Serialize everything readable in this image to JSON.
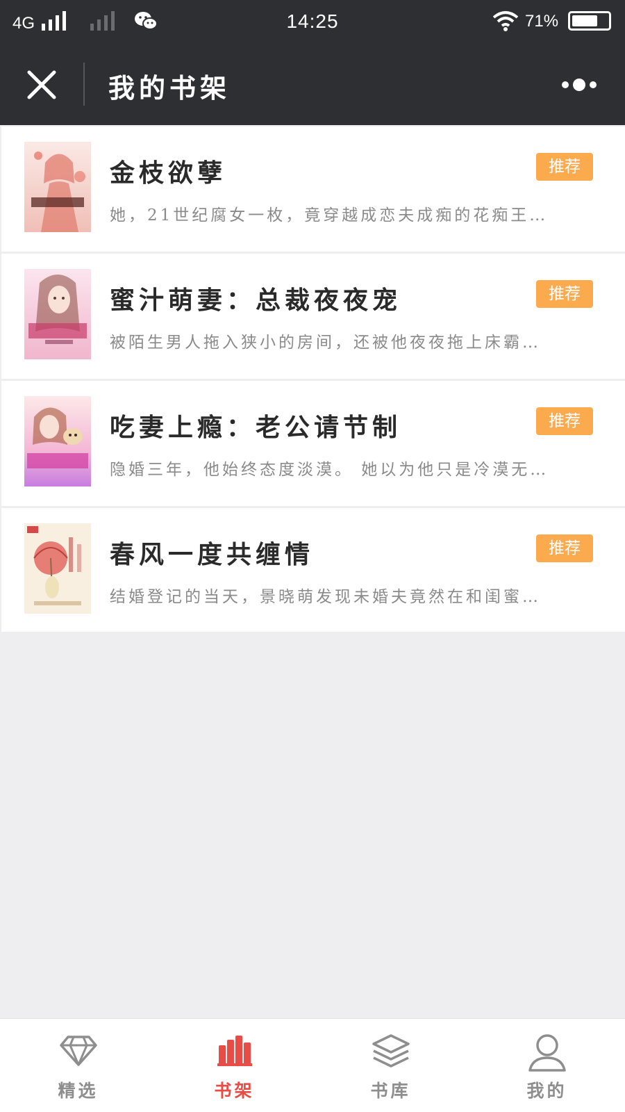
{
  "status_bar": {
    "network": "4G",
    "time": "14:25",
    "battery_percent": "71%",
    "battery_level": 0.71
  },
  "header": {
    "title": "我的书架",
    "close_icon": "close-icon",
    "more_icon": "more-icon"
  },
  "books": [
    {
      "title": "金枝欲孽",
      "description": "她，21世纪腐女一枚，竟穿越成恋夫成痴的花痴王…",
      "badge": "推荐",
      "cover_colors": [
        "#f4d8d4",
        "#e8a9a2"
      ]
    },
    {
      "title": "蜜汁萌妻：总裁夜夜宠",
      "description": "被陌生男人拖入狭小的房间，还被他夜夜拖上床霸…",
      "badge": "推荐",
      "cover_colors": [
        "#f8dbe6",
        "#e9a6c1"
      ]
    },
    {
      "title": "吃妻上瘾：老公请节制",
      "description": "隐婚三年，他始终态度淡漠。 她以为他只是冷漠无…",
      "badge": "推荐",
      "cover_colors": [
        "#f5c9de",
        "#b56fd4"
      ]
    },
    {
      "title": "春风一度共缠情",
      "description": "结婚登记的当天，景晓萌发现未婚夫竟然在和闺蜜…",
      "badge": "推荐",
      "cover_colors": [
        "#f7ecdc",
        "#e8736a"
      ]
    }
  ],
  "nav": [
    {
      "label": "精选",
      "icon": "diamond-icon",
      "active": false
    },
    {
      "label": "书架",
      "icon": "bookshelf-icon",
      "active": true
    },
    {
      "label": "书库",
      "icon": "layers-icon",
      "active": false
    },
    {
      "label": "我的",
      "icon": "person-icon",
      "active": false
    }
  ],
  "colors": {
    "header_bg": "#2e2f33",
    "badge_bg": "#fcaa4e",
    "active_nav": "#e74c46",
    "inactive_nav": "#8e8e8e",
    "page_bg": "#eeedf0"
  }
}
